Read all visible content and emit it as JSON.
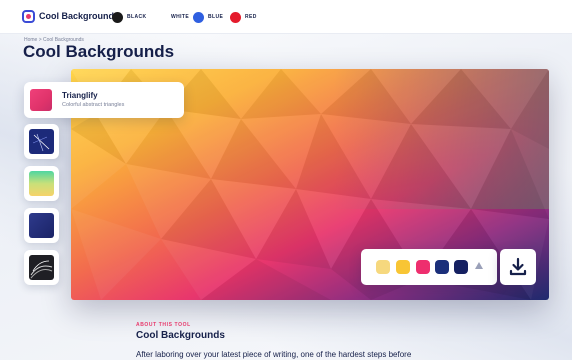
{
  "nav": {
    "brand": "Cool Backgrounds",
    "color_options": [
      {
        "label": "BLACK",
        "color": "#1a1a1a"
      },
      {
        "label": "WHITE",
        "color": "#ffffff"
      },
      {
        "label": "BLUE",
        "color": "#2f5fe0"
      },
      {
        "label": "RED",
        "color": "#e41b2c"
      }
    ]
  },
  "breadcrumb": "Home  >  Cool Backgrounds",
  "page_title": "Cool Backgrounds",
  "tools": {
    "active": {
      "title": "Trianglify",
      "subtitle": "Colorful abstract triangles"
    }
  },
  "palette": {
    "colors": [
      "#f6d87e",
      "#f8c534",
      "#ee2e6e",
      "#1b2f7a",
      "#152061"
    ]
  },
  "icons": {
    "download": "download-icon",
    "palette_shuffle": "triangle-icon"
  },
  "about": {
    "kicker": "ABOUT THIS TOOL",
    "title": "Cool Backgrounds",
    "body": "After laboring over your latest piece of writing, one of the hardest steps before"
  }
}
